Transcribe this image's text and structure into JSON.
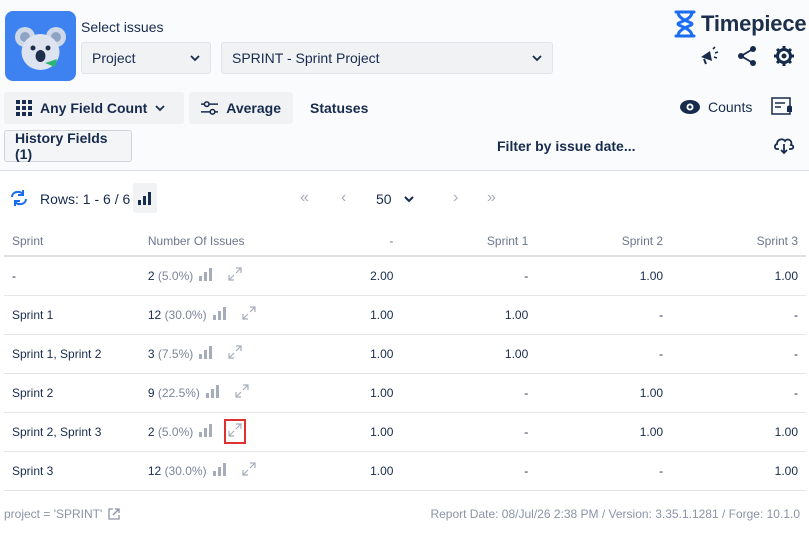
{
  "header": {
    "select_issues_label": "Select issues",
    "project_dropdown": "Project",
    "sprint_dropdown": "SPRINT - Sprint Project",
    "brand": "Timepiece"
  },
  "toolbar": {
    "any_field_count": "Any Field Count",
    "average": "Average",
    "statuses": "Statuses",
    "counts": "Counts",
    "history_fields": "History Fields (1)",
    "filter_by_date": "Filter by issue date..."
  },
  "pager": {
    "rows_text": "Rows: 1 - 6 / 6",
    "page_size": "50",
    "first": "«",
    "prev": "‹",
    "next": "›",
    "last": "»"
  },
  "table": {
    "columns": [
      "Sprint",
      "Number Of Issues",
      "-",
      "Sprint 1",
      "Sprint 2",
      "Sprint 3"
    ],
    "rows": [
      {
        "sprint": "-",
        "count": "2",
        "pct": "(5.0%)",
        "c0": "2.00",
        "c1": "-",
        "c2": "1.00",
        "c3": "1.00"
      },
      {
        "sprint": "Sprint 1",
        "count": "12",
        "pct": "(30.0%)",
        "c0": "1.00",
        "c1": "1.00",
        "c2": "-",
        "c3": "-"
      },
      {
        "sprint": "Sprint 1, Sprint 2",
        "count": "3",
        "pct": "(7.5%)",
        "c0": "1.00",
        "c1": "1.00",
        "c2": "-",
        "c3": "-"
      },
      {
        "sprint": "Sprint 2",
        "count": "9",
        "pct": "(22.5%)",
        "c0": "1.00",
        "c1": "-",
        "c2": "1.00",
        "c3": "-"
      },
      {
        "sprint": "Sprint 2, Sprint 3",
        "count": "2",
        "pct": "(5.0%)",
        "c0": "1.00",
        "c1": "-",
        "c2": "1.00",
        "c3": "1.00"
      },
      {
        "sprint": "Sprint 3",
        "count": "12",
        "pct": "(30.0%)",
        "c0": "1.00",
        "c1": "-",
        "c2": "-",
        "c3": "1.00"
      }
    ]
  },
  "footer": {
    "jql": "project = 'SPRINT'",
    "report_info": "Report Date: 08/Jul/26 2:38 PM / Version: 3.35.1.1281 / Forge: 10.1.0"
  },
  "colors": {
    "accent": "#0c66e4",
    "logo_bg": "#3d82f0",
    "highlight": "#e03131"
  }
}
